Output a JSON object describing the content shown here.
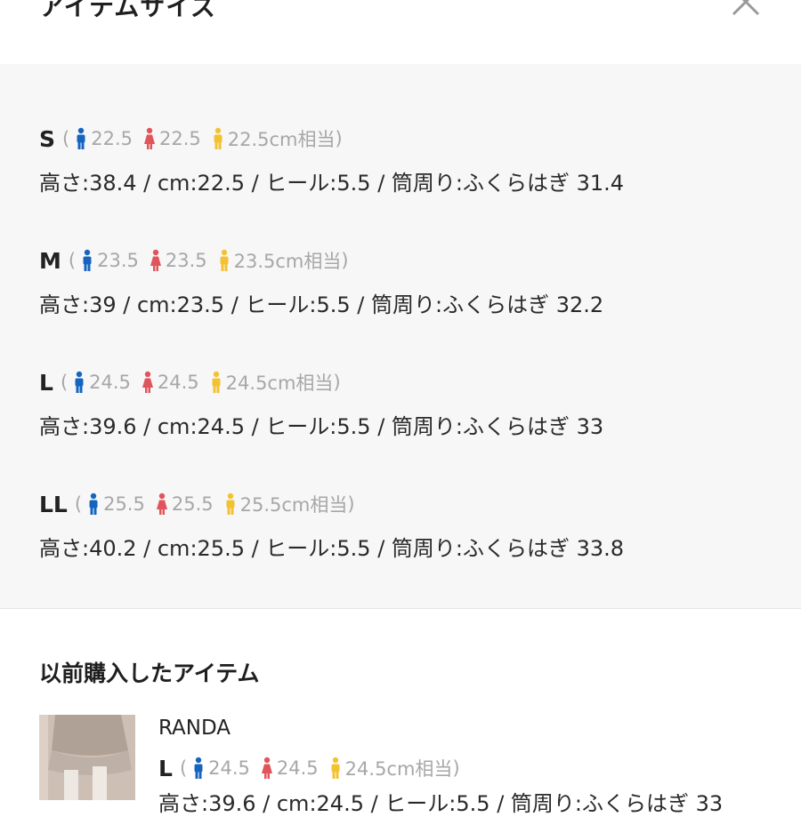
{
  "header": {
    "title": "アイテムサイズ"
  },
  "sizes": [
    {
      "label": "S",
      "men": "22.5",
      "women": "22.5",
      "unisex": "22.5cm相当",
      "spec": "高さ:38.4 / cm:22.5 / ヒール:5.5 / 筒周り:ふくらはぎ 31.4"
    },
    {
      "label": "M",
      "men": "23.5",
      "women": "23.5",
      "unisex": "23.5cm相当",
      "spec": "高さ:39 / cm:23.5 / ヒール:5.5 / 筒周り:ふくらはぎ 32.2"
    },
    {
      "label": "L",
      "men": "24.5",
      "women": "24.5",
      "unisex": "24.5cm相当",
      "spec": "高さ:39.6 / cm:24.5 / ヒール:5.5 / 筒周り:ふくらはぎ 33"
    },
    {
      "label": "LL",
      "men": "25.5",
      "women": "25.5",
      "unisex": "25.5cm相当",
      "spec": "高さ:40.2 / cm:25.5 / ヒール:5.5 / 筒周り:ふくらはぎ 33.8"
    }
  ],
  "paren_open": "(",
  "paren_close": ")",
  "previous": {
    "title": "以前購入したアイテム",
    "brand": "RANDA",
    "size_label": "L",
    "men": "24.5",
    "women": "24.5",
    "unisex": "24.5cm相当",
    "spec": "高さ:39.6 / cm:24.5 / ヒール:5.5 / 筒周り:ふくらはぎ 33"
  },
  "colors": {
    "men": "#1565c0",
    "women": "#e0555b",
    "unisex": "#f2c232",
    "panel": "#f7f7f7"
  },
  "icons": [
    "close-icon",
    "man-icon",
    "woman-icon",
    "unisex-icon"
  ]
}
